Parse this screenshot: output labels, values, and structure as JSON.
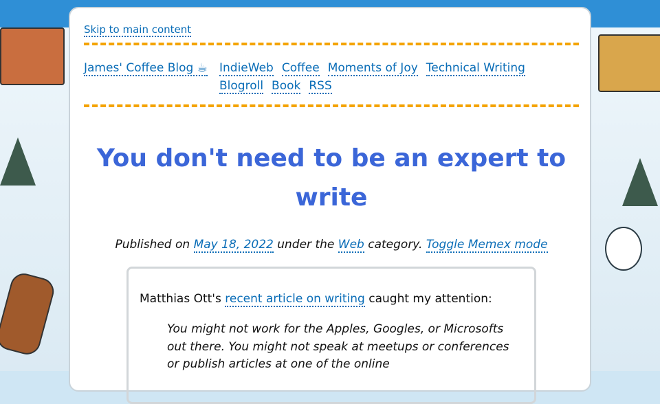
{
  "header": {
    "skip_link": "Skip to main content",
    "site_title": "James' Coffee Blog ☕",
    "nav": [
      "IndieWeb",
      "Coffee",
      "Moments of Joy",
      "Technical Writing",
      "Blogroll",
      "Book",
      "RSS"
    ]
  },
  "post": {
    "title": "You don't need to be an expert to write",
    "meta": {
      "published_prefix": "Published on ",
      "date": "May 18, 2022",
      "under": " under the ",
      "category": "Web",
      "category_suffix": " category. ",
      "toggle": "Toggle Memex mode"
    },
    "intro": {
      "author": "Matthias Ott's ",
      "link": "recent article on writing",
      "rest": " caught my attention:"
    },
    "quote": "You might not work for the Apples, Googles, or Microsofts out there. You might not speak at meetups or conferences or publish articles at one of the online"
  },
  "colors": {
    "accent_dash": "#f4a300",
    "link": "#0a6db7",
    "title": "#3b66d8"
  }
}
